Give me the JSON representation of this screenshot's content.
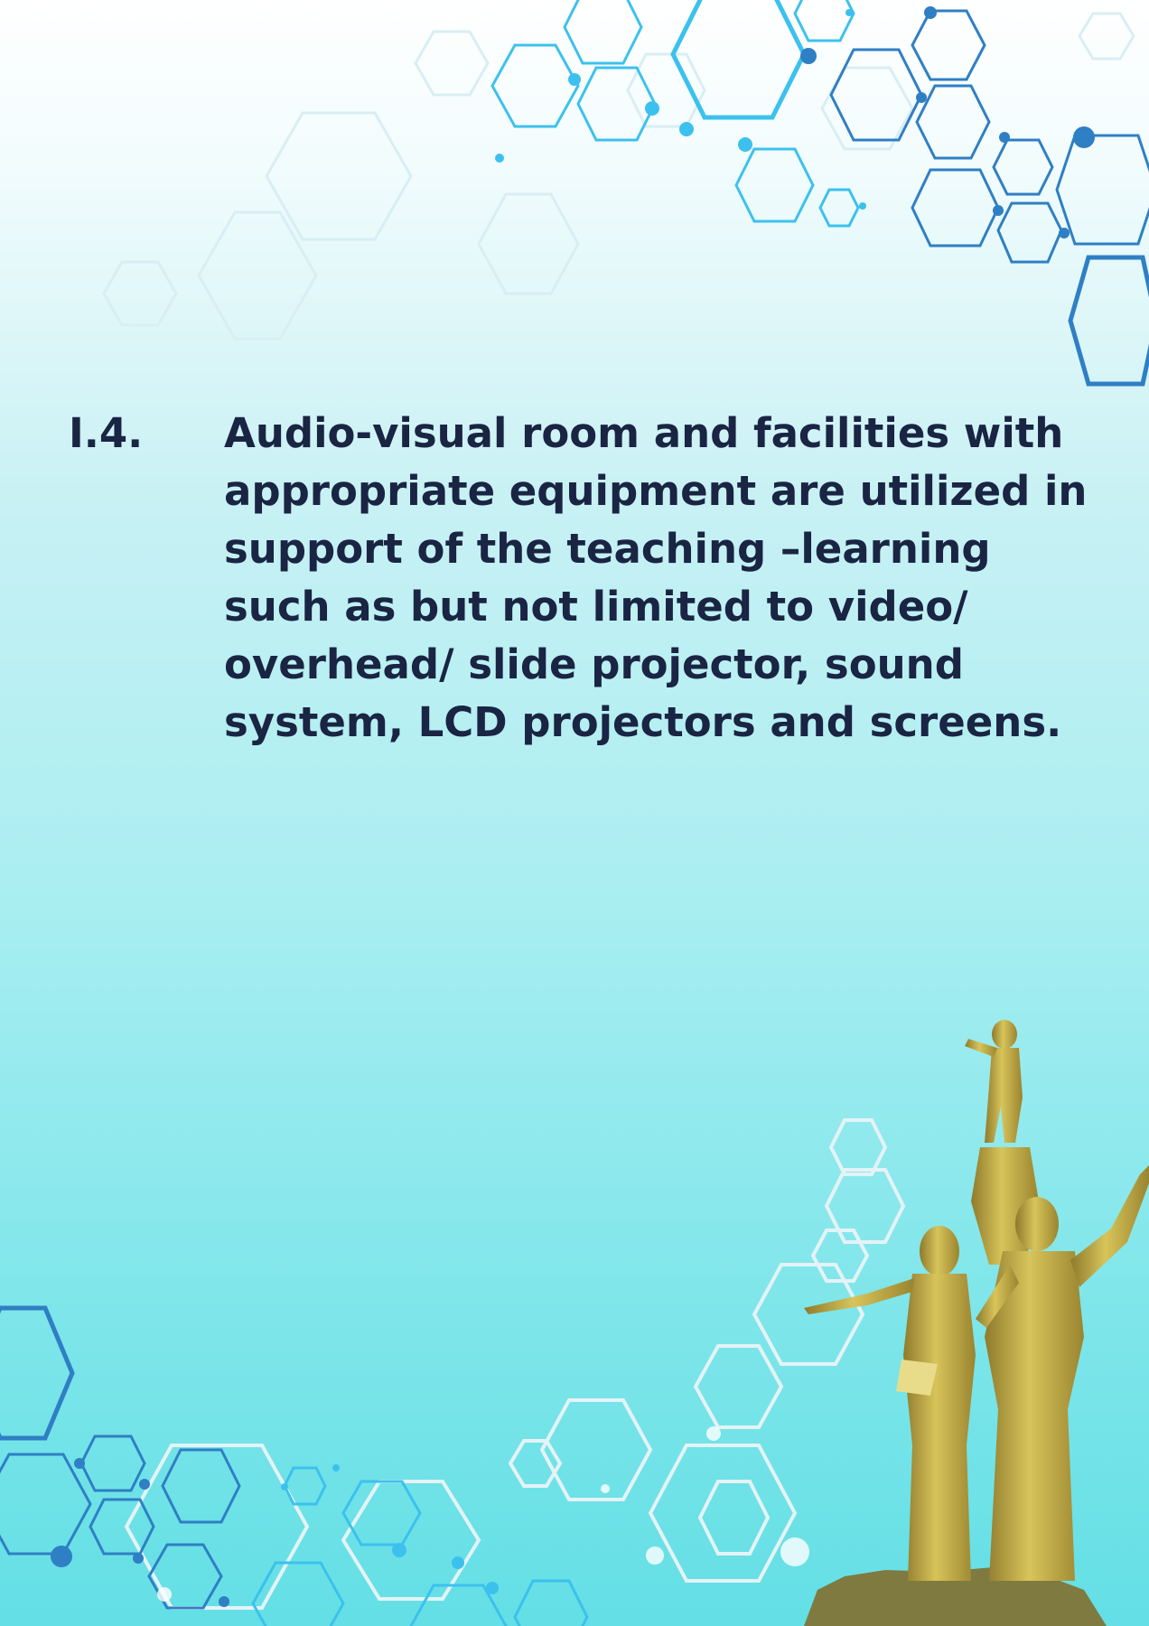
{
  "criterion": {
    "number": "I.4.",
    "text": "Audio-visual room and facilities with appropriate equipment are utilized in support of the teaching –learning such as but not limited to video/ overhead/ slide projector, sound system, LCD projectors and screens."
  },
  "decorations": {
    "pattern": "hexagon-network",
    "statue": "golden-monument-statue",
    "colors": {
      "text": "#1a2443",
      "hex_dark": "#2f7fc4",
      "hex_light": "#3cc1ee",
      "hex_faint": "#e4f3f7",
      "statue_gold": "#c7b24a",
      "background_top": "#ffffff",
      "background_bottom": "#63dfe5"
    }
  }
}
